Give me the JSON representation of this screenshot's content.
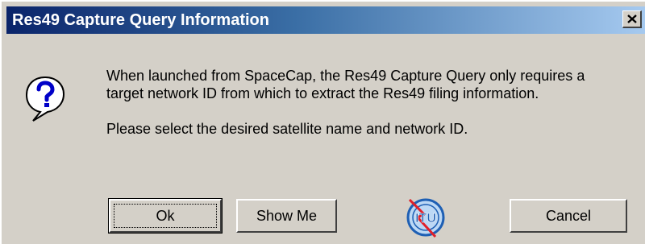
{
  "dialog": {
    "title": "Res49 Capture Query Information",
    "close_label": "x",
    "icon": "question-icon",
    "message_line1": "When launched from SpaceCap, the Res49 Capture Query only requires a target network ID from which to extract the Res49 filing information.",
    "message_line2": "Please select the desired satellite name and network ID."
  },
  "buttons": {
    "ok_label": "Ok",
    "show_me_label": "Show Me",
    "cancel_label": "Cancel"
  },
  "logo": {
    "text": "ITU",
    "icon": "itu-logo-icon"
  },
  "colors": {
    "titlebar_start": "#0a246a",
    "titlebar_end": "#a6caf0",
    "dialog_bg": "#d4d0c8",
    "logo_blue": "#1e5fb4",
    "logo_red": "#e0202a"
  }
}
